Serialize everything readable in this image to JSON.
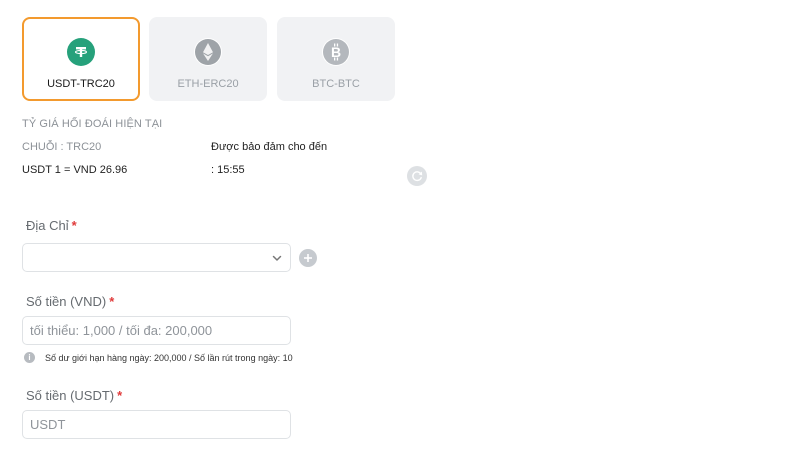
{
  "coins": [
    {
      "label": "USDT-TRC20",
      "icon": "tether-icon",
      "color": "#26a17b",
      "active": true
    },
    {
      "label": "ETH-ERC20",
      "icon": "ethereum-icon",
      "color": "#9ea3a8",
      "active": false
    },
    {
      "label": "BTC-BTC",
      "icon": "bitcoin-icon",
      "color": "#b4b8bd",
      "active": false
    }
  ],
  "rate_info": {
    "title": "TỶ GIÁ HỐI ĐOÁI HIỆN TẠI",
    "chain": "CHUỖI : TRC20",
    "rate": "USDT 1 = VND 26.96",
    "guaranteed_label": "Được bảo đảm cho đến",
    "time": ": 15:55"
  },
  "address": {
    "label": "Địa Chỉ",
    "required_mark": "*",
    "value": ""
  },
  "amount_vnd": {
    "label": "Số tiền (VND)",
    "required_mark": "*",
    "value": "",
    "placeholder": "tối thiểu: 1,000 / tối đa: 200,000"
  },
  "limit_note": {
    "icon": "info-icon",
    "text": "Số dư giới hạn hàng ngày: 200,000 / Số lần rút trong ngày: 10"
  },
  "amount_usdt": {
    "label": "Số tiền (USDT)",
    "required_mark": "*",
    "value": "",
    "placeholder": "USDT"
  },
  "colors": {
    "accent": "#f39a2e",
    "required": "#e03a3a",
    "tether": "#26a17b"
  }
}
